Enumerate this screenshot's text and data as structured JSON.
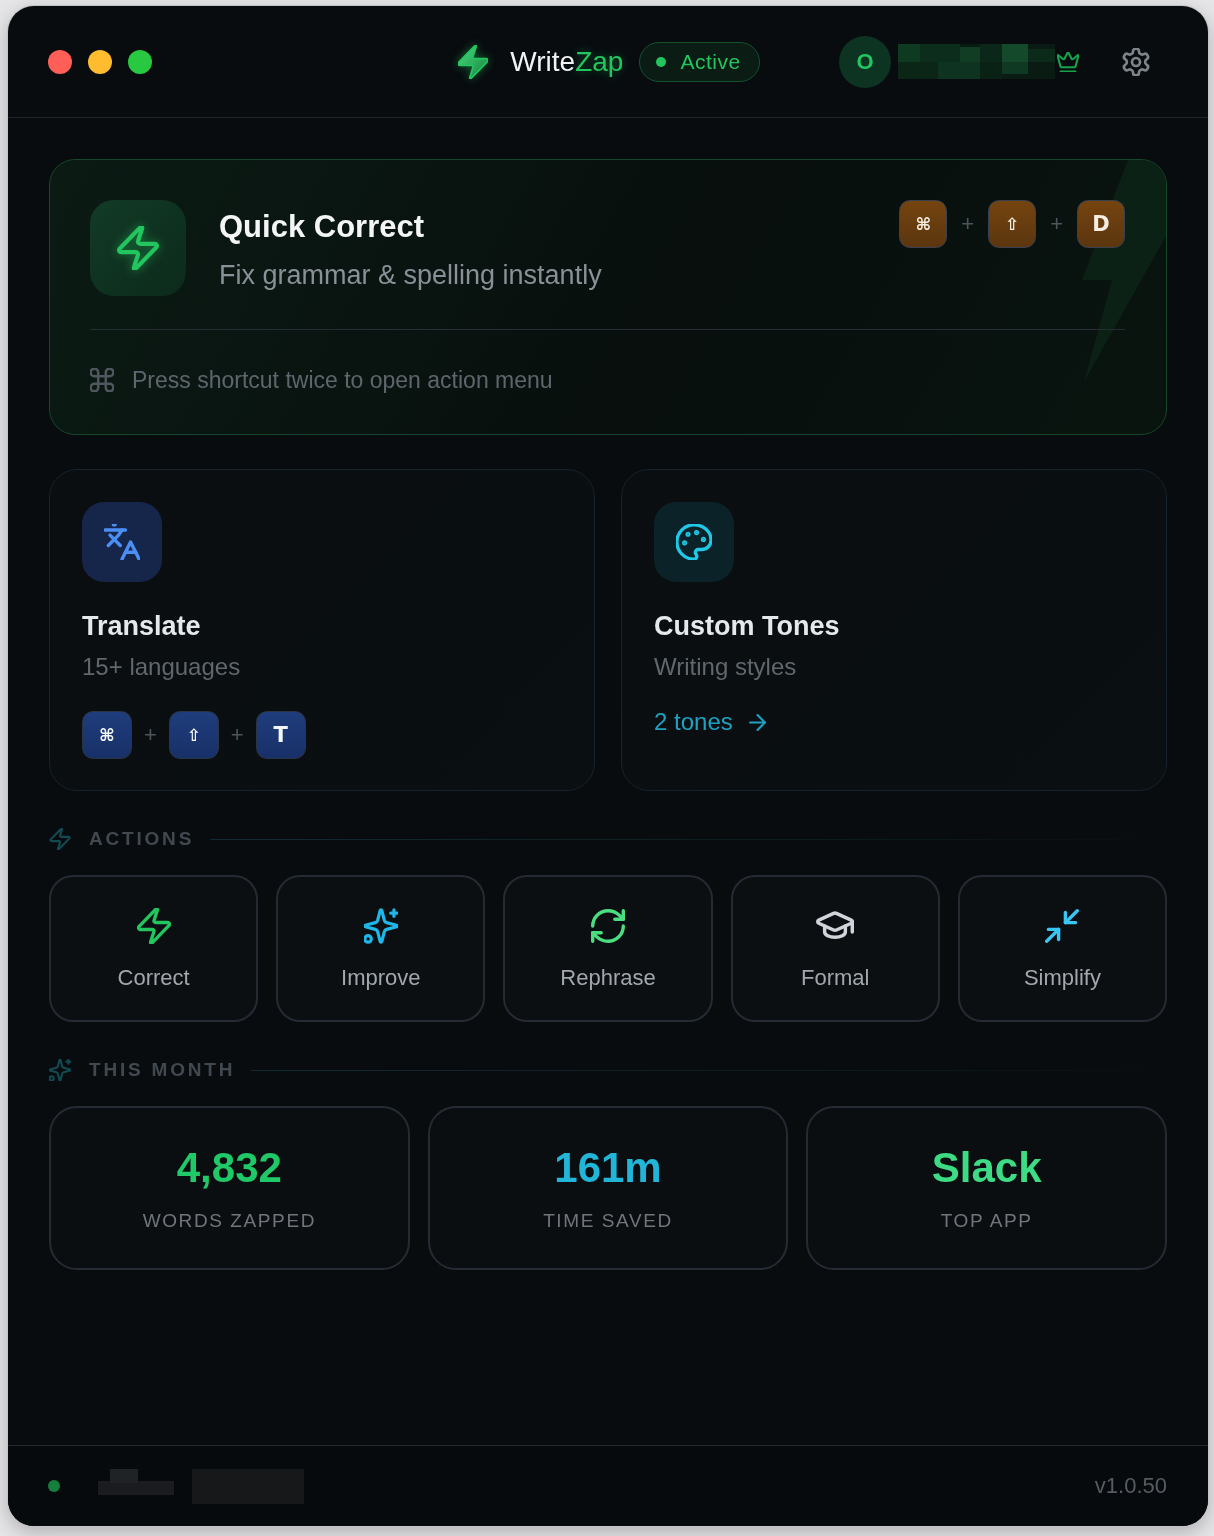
{
  "header": {
    "app_name": {
      "text": "Write",
      "accent": "Zap"
    },
    "status": {
      "label": "Active",
      "on": true
    },
    "avatar": {
      "initial": "O"
    }
  },
  "quick_correct": {
    "title": "Quick Correct",
    "subtitle": "Fix grammar & spelling instantly",
    "shortcut": {
      "keys": [
        "⌘",
        "⇧",
        "D"
      ],
      "separators": [
        "+",
        "+"
      ]
    },
    "hint": "Press shortcut twice to open action menu"
  },
  "features": [
    {
      "kind": "shortcut",
      "title": "Translate",
      "subtitle": "15+ languages",
      "shortcut": {
        "keys": [
          "⌘",
          "⇧",
          "T"
        ],
        "separators": [
          "+",
          "+"
        ]
      }
    },
    {
      "kind": "link",
      "title": "Custom Tones",
      "subtitle": "Writing styles",
      "link": "2 tones"
    }
  ],
  "actions": {
    "title": "ACTIONS",
    "items": [
      {
        "label": "Correct",
        "color": "#22c55e"
      },
      {
        "label": "Improve",
        "color": "#1fb6e8"
      },
      {
        "label": "Rephrase",
        "color": "#4ade80"
      },
      {
        "label": "Formal",
        "color": "#d1d5db"
      },
      {
        "label": "Simplify",
        "color": "#38c6f4"
      }
    ]
  },
  "this_month": {
    "title": "THIS MONTH",
    "stats": [
      {
        "value": "4,832",
        "label": "WORDS ZAPPED",
        "color": "#20c968"
      },
      {
        "value": "161m",
        "label": "TIME SAVED",
        "color": "#22b5d8"
      },
      {
        "value": "Slack",
        "label": "TOP APP",
        "color": "#3ddc84"
      }
    ]
  },
  "footer": {
    "online": true,
    "version": "v1.0.50"
  }
}
